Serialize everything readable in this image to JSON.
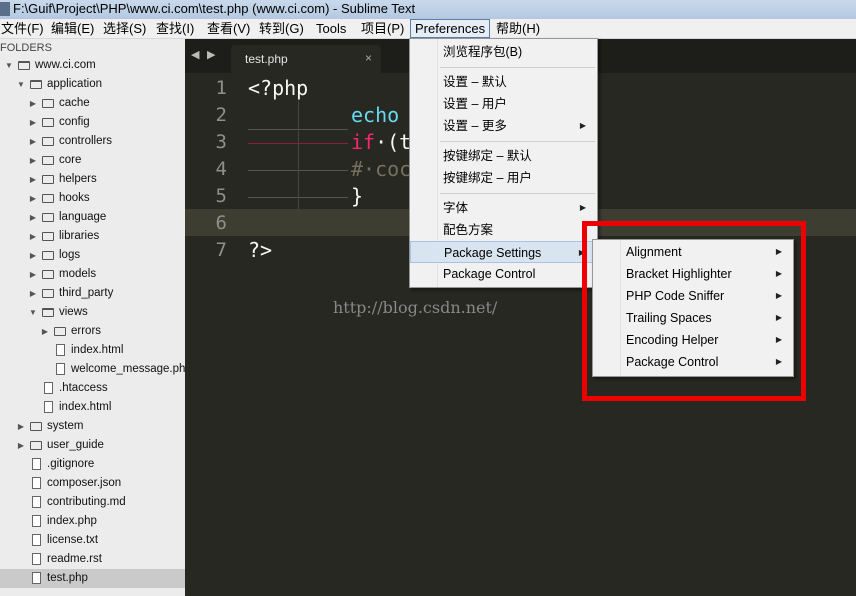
{
  "window": {
    "title": "F:\\Guif\\Project\\PHP\\www.ci.com\\test.php (www.ci.com) - Sublime Text"
  },
  "menubar": [
    {
      "label": "文件(F)"
    },
    {
      "label": "编辑(E)"
    },
    {
      "label": "选择(S)"
    },
    {
      "label": "查找(I)"
    },
    {
      "label": "查看(V)"
    },
    {
      "label": "转到(G)"
    },
    {
      "label": "Tools"
    },
    {
      "label": "项目(P)"
    },
    {
      "label": "Preferences"
    },
    {
      "label": "帮助(H)"
    }
  ],
  "sidebar": {
    "header": "FOLDERS",
    "items": [
      {
        "label": "www.ci.com",
        "type": "folder",
        "open": true
      },
      {
        "label": "application",
        "type": "folder",
        "open": true
      },
      {
        "label": "cache",
        "type": "folder"
      },
      {
        "label": "config",
        "type": "folder"
      },
      {
        "label": "controllers",
        "type": "folder"
      },
      {
        "label": "core",
        "type": "folder"
      },
      {
        "label": "helpers",
        "type": "folder"
      },
      {
        "label": "hooks",
        "type": "folder"
      },
      {
        "label": "language",
        "type": "folder"
      },
      {
        "label": "libraries",
        "type": "folder"
      },
      {
        "label": "logs",
        "type": "folder"
      },
      {
        "label": "models",
        "type": "folder"
      },
      {
        "label": "third_party",
        "type": "folder"
      },
      {
        "label": "views",
        "type": "folder",
        "open": true
      },
      {
        "label": "errors",
        "type": "folder"
      },
      {
        "label": "index.html",
        "type": "file"
      },
      {
        "label": "welcome_message.php",
        "type": "file"
      },
      {
        "label": ".htaccess",
        "type": "file"
      },
      {
        "label": "index.html",
        "type": "file"
      },
      {
        "label": "system",
        "type": "folder"
      },
      {
        "label": "user_guide",
        "type": "folder"
      },
      {
        "label": ".gitignore",
        "type": "file"
      },
      {
        "label": "composer.json",
        "type": "file"
      },
      {
        "label": "contributing.md",
        "type": "file"
      },
      {
        "label": "index.php",
        "type": "file"
      },
      {
        "label": "license.txt",
        "type": "file"
      },
      {
        "label": "readme.rst",
        "type": "file"
      },
      {
        "label": "test.php",
        "type": "file",
        "selected": true
      }
    ]
  },
  "tabs": {
    "active": "test.php",
    "close": "×",
    "nav_left": "◀",
    "nav_right": "▶"
  },
  "editor": {
    "line_numbers": [
      "1",
      "2",
      "3",
      "4",
      "5",
      "6",
      "7"
    ],
    "code": [
      [
        {
          "t": "<?php",
          "c": "#f8f8f2"
        }
      ],
      [
        {
          "t": "echo",
          "c": "#66d9ef"
        }
      ],
      [
        {
          "t": "if",
          "c": "#f92672"
        },
        {
          "t": "·(t",
          "c": "#f8f8f2"
        }
      ],
      [
        {
          "t": "#·coc",
          "c": "#75715e"
        }
      ],
      [
        {
          "t": "}",
          "c": "#f8f8f2"
        }
      ],
      [],
      [
        {
          "t": "?>",
          "c": "#f8f8f2"
        }
      ]
    ],
    "current_line": 6,
    "watermark": "http://blog.csdn.net/"
  },
  "preferences_menu": {
    "items": [
      {
        "label": "浏览程序包(B)"
      },
      {
        "label": "设置 – 默认"
      },
      {
        "label": "设置 – 用户"
      },
      {
        "label": "设置 – 更多",
        "submenu": true
      },
      {
        "label": "按键绑定 – 默认"
      },
      {
        "label": "按键绑定 – 用户"
      },
      {
        "label": "字体",
        "submenu": true
      },
      {
        "label": "配色方案"
      },
      {
        "label": "Package Settings",
        "submenu": true,
        "highlighted": true
      },
      {
        "label": "Package Control"
      }
    ]
  },
  "package_settings_submenu": {
    "items": [
      {
        "label": "Alignment"
      },
      {
        "label": "Bracket Highlighter"
      },
      {
        "label": "PHP Code Sniffer"
      },
      {
        "label": "Trailing Spaces"
      },
      {
        "label": "Encoding Helper"
      },
      {
        "label": "Package Control"
      }
    ]
  },
  "colors": {
    "annotation": "#ee0000",
    "editor_bg": "#272822"
  }
}
